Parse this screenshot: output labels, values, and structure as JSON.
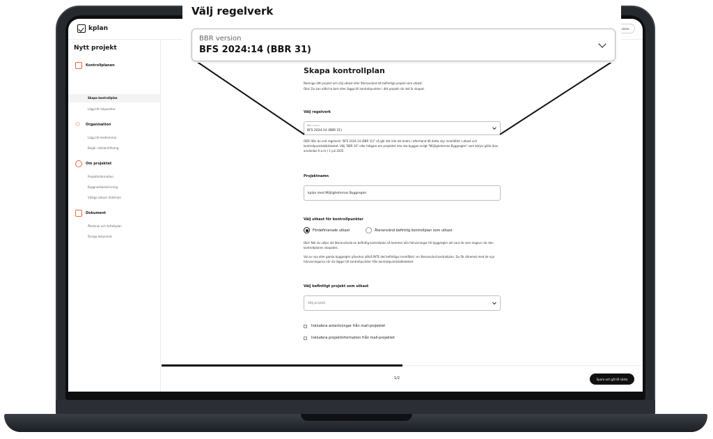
{
  "app": {
    "logo": "kplan",
    "next_pill": "nästa"
  },
  "callout": {
    "title": "Välj regelverk",
    "field_label": "BBR version",
    "field_value": "BFS 2024:14 (BBR 31)"
  },
  "sidebar": {
    "title": "Nytt projekt",
    "sections": [
      {
        "label": "Kontrollplanen",
        "icon": "document-icon",
        "items": [
          "Skapa kontrollplan",
          "Lägg till riskpunkter"
        ]
      },
      {
        "label": "Organisation",
        "icon": "people-icon",
        "items": [
          "Lägg till medlemmar",
          "Begär riskidentifiering"
        ]
      },
      {
        "label": "Om projektet",
        "icon": "info-icon",
        "items": [
          "Projektinformation",
          "Byggnadsbeskrivning",
          "Viktiga datum (tidslinje)"
        ]
      },
      {
        "label": "Dokument",
        "icon": "file-icon",
        "items": [
          "Återbruk och Avfallsplan",
          "Övriga dokument"
        ]
      }
    ]
  },
  "form": {
    "title": "Skapa kontrollplan",
    "intro_1": "Namnge ditt projekt och välj utkast eller återanvänd ett befintligt projekt som utkast.",
    "intro_2": "Obs! Du kan alltid ta bort eller lägga till kontrollpunkter i ditt projekt när det är skapat.",
    "regelverk_label": "Välj regelverk",
    "bbr_small": "BBR version",
    "bbr_value": "BFS 2024:14 (BBR 31)",
    "regelverk_note": "OBS! När du valt regelverk \"BFS 2024:14 (BBR 31)\" så går det inte att ändra i efterhand då detta styr innehållet i utkast och kontrollpunktsbiblioteket. Välj \"BBR 30\" eller tidigare om projektet inte ska byggas enligt \"Möjligheternas Byggregler\" som börjar gälla (kan användas fr.o.m.) 1 juli 2025",
    "project_name_label": "Projektnamn",
    "project_name_value": "kplan med Möjligheternas Byggregler",
    "utkast_label": "Välj utkast för kontrollpunkter",
    "radio_1": "Fördefinierade utkast",
    "radio_2": "Återanvänd befintlig kontrollplan som utkast",
    "utkast_note_1": "Obs! När du väljer att återanvända en befintlig kontrollplan så kommer alla hänvisningar till byggregler att vara de som angavs när den kontrollplanen skapades.",
    "utkast_note_2": "Val av nya eller gamla byggregler påverkar alltså INTE det befintliga innehållet i en återanvänd kontrollplan. Du får däremot med de nya hänvisningarna när du lägger till kontrollpunkter från kontrollpunktsbiblioteket.",
    "existing_label": "Välj befintligt projekt som utkast",
    "existing_placeholder": "Välj projekt",
    "check_1": "Inkludera anteckningar från mall-projektet",
    "check_2": "Inkludera projektinformation från mall-projektet"
  },
  "footer": {
    "pager": "1/2",
    "save_label": "Spara och gå till nästa",
    "progress": 0.5
  }
}
